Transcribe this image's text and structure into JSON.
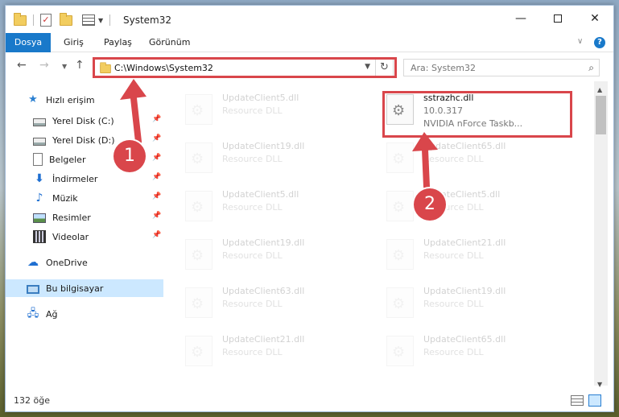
{
  "window": {
    "title": "System32"
  },
  "ribbon": {
    "tabs": [
      "Dosya",
      "Giriş",
      "Paylaş",
      "Görünüm"
    ]
  },
  "address": {
    "path": "C:\\Windows\\System32",
    "search_placeholder": "Ara: System32"
  },
  "sidebar": {
    "quick_access": "Hızlı erişim",
    "items": [
      {
        "label": "Yerel Disk (C:)",
        "icon": "drive-icon",
        "pinned": true
      },
      {
        "label": "Yerel Disk (D:)",
        "icon": "drive-icon",
        "pinned": true
      },
      {
        "label": "Belgeler",
        "icon": "documents-icon",
        "pinned": true
      },
      {
        "label": "İndirmeler",
        "icon": "downloads-icon",
        "pinned": true
      },
      {
        "label": "Müzik",
        "icon": "music-icon",
        "pinned": true
      },
      {
        "label": "Resimler",
        "icon": "pictures-icon",
        "pinned": true
      },
      {
        "label": "Videolar",
        "icon": "videos-icon",
        "pinned": true
      }
    ],
    "onedrive": "OneDrive",
    "this_pc": "Bu bilgisayar",
    "network": "Ağ"
  },
  "files": {
    "selected": {
      "name": "sstrazhc.dll",
      "version": "10.0.317",
      "description": "NVIDIA nForce Taskb..."
    },
    "ghost_left": [
      {
        "name": "UpdateClient5.dll",
        "type": "Resource DLL"
      },
      {
        "name": "UpdateClient19.dll",
        "type": "Resource DLL"
      },
      {
        "name": "UpdateClient5.dll",
        "type": "Resource DLL"
      },
      {
        "name": "UpdateClient19.dll",
        "type": "Resource DLL"
      },
      {
        "name": "UpdateClient63.dll",
        "type": "Resource DLL"
      },
      {
        "name": "UpdateClient21.dll",
        "type": "Resource DLL"
      }
    ],
    "ghost_right": [
      {
        "name": "UpdateClient65.dll",
        "type": "Resource DLL"
      },
      {
        "name": "UpdateClient5.dll",
        "type": "Resource DLL"
      },
      {
        "name": "UpdateClient21.dll",
        "type": "Resource DLL"
      },
      {
        "name": "UpdateClient19.dll",
        "type": "Resource DLL"
      },
      {
        "name": "UpdateClient65.dll",
        "type": "Resource DLL"
      }
    ]
  },
  "callouts": [
    "1",
    "2"
  ],
  "status": {
    "count": "132 öğe"
  }
}
